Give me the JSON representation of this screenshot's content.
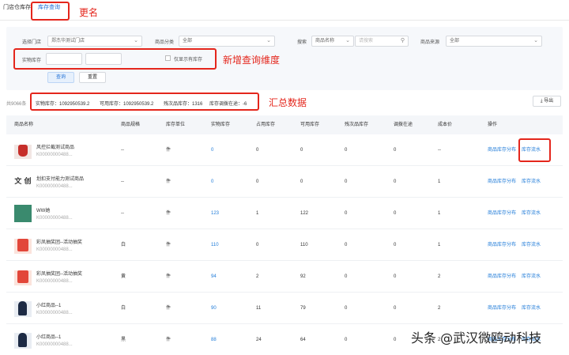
{
  "tabs": [
    {
      "label": "门店仓库存",
      "active": false
    },
    {
      "label": "库存查询",
      "active": true
    }
  ],
  "annotations": {
    "rename": "更名",
    "new_dimension": "新增查询维度",
    "summary_data": "汇总数据"
  },
  "filters": {
    "store_label": "选择门店",
    "store_value": "郑杰华测试门店",
    "category_label": "商品分类",
    "category_value": "全部",
    "search_label": "搜索",
    "search_field": "商品名称",
    "search_placeholder": "请搜索",
    "source_label": "商品来源",
    "source_value": "全部",
    "stock_label": "实物库存",
    "only_stock_label": "仅显示有库存",
    "query_button": "查询",
    "reset_button": "重置"
  },
  "summary": {
    "total": "共9066条",
    "physical": "实物库存：1092950539.2",
    "available": "可用库存：1092950539.2",
    "defective": "残次品库存：1316",
    "transfer": "库存调拨在途：-6",
    "export": "导出"
  },
  "columns": [
    "商品名称",
    "商品规格",
    "库存单位",
    "实物库存",
    "占用库存",
    "可用库存",
    "残次品库存",
    "调拨在途",
    "成本价",
    "操作"
  ],
  "actions": {
    "distribution": "商品库存分布",
    "flow": "库存流水"
  },
  "rows": [
    {
      "name": "风控拦截测试商品",
      "code": "K00000000488...",
      "spec": "--",
      "unit": "件",
      "physical": "0",
      "occupied": "0",
      "available": "0",
      "defective": "0",
      "transfer": "0",
      "cost": "--",
      "thumb": "red-bag"
    },
    {
      "name": "划扣支付能力测试商品",
      "code": "K00000000488...",
      "spec": "--",
      "unit": "件",
      "physical": "0",
      "occupied": "0",
      "available": "0",
      "defective": "0",
      "transfer": "0",
      "cost": "1",
      "thumb": "text-logo",
      "thumb_text": "文 创"
    },
    {
      "name": "WW她",
      "code": "K00000000488...",
      "spec": "--",
      "unit": "件",
      "physical": "123",
      "occupied": "1",
      "available": "122",
      "defective": "0",
      "transfer": "0",
      "cost": "1",
      "thumb": "green-square"
    },
    {
      "name": "彩凤抽奖团--活动抽奖",
      "code": "K00000000488...",
      "spec": "白",
      "unit": "件",
      "physical": "110",
      "occupied": "0",
      "available": "110",
      "defective": "0",
      "transfer": "0",
      "cost": "1",
      "thumb": "red-card"
    },
    {
      "name": "彩凤抽奖团--活动抽奖",
      "code": "K00000000488...",
      "spec": "黄",
      "unit": "件",
      "physical": "94",
      "occupied": "2",
      "available": "92",
      "defective": "0",
      "transfer": "0",
      "cost": "2",
      "thumb": "red-card"
    },
    {
      "name": "小红商品--1",
      "code": "K00000000488...",
      "spec": "白",
      "unit": "件",
      "physical": "90",
      "occupied": "11",
      "available": "79",
      "defective": "0",
      "transfer": "0",
      "cost": "2",
      "thumb": "dark-figure"
    },
    {
      "name": "小红商品--1",
      "code": "K00000000488...",
      "spec": "黑",
      "unit": "件",
      "physical": "88",
      "occupied": "24",
      "available": "64",
      "defective": "0",
      "transfer": "0",
      "cost": "2",
      "thumb": "dark-figure"
    }
  ],
  "watermark": "头条 @武汉微鸥动科技",
  "colors": {
    "accent": "#1f6fd6",
    "link": "#1f7bd8",
    "annotation": "#e4261c"
  }
}
